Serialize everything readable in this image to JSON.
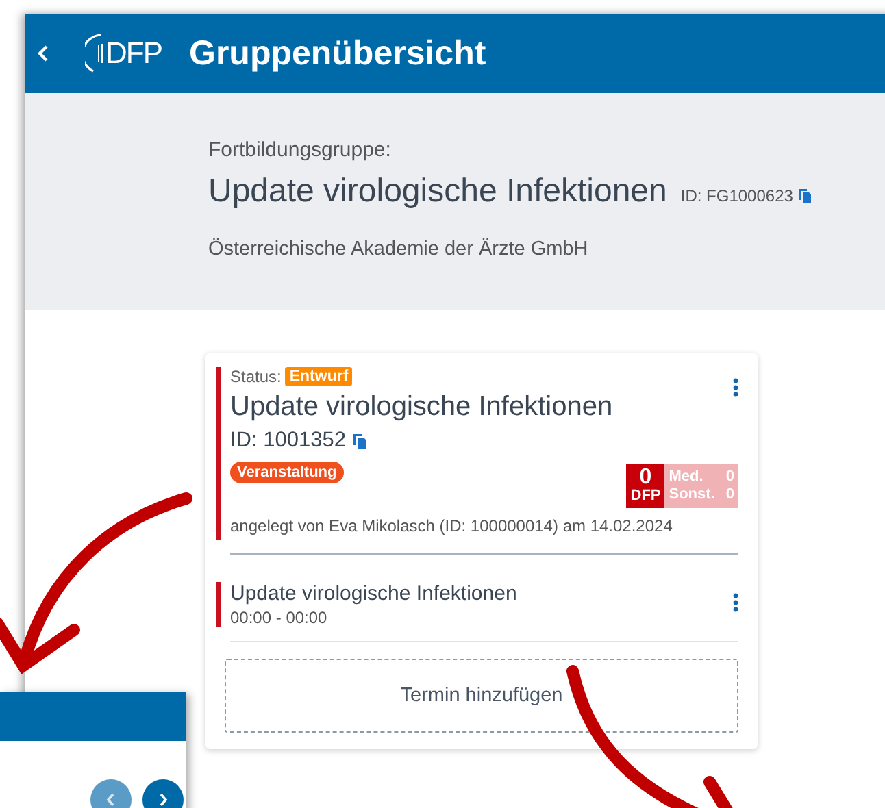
{
  "header": {
    "title": "Gruppenübersicht",
    "logo": "DFP"
  },
  "group": {
    "label": "Fortbildungsgruppe:",
    "name": "Update virologische Infektionen",
    "id": "ID: FG1000623",
    "organization": "Österreichische Akademie der Ärzte GmbH"
  },
  "event_card": {
    "status_label": "Status:",
    "status": "Entwurf",
    "title": "Update virologische Infektionen",
    "id": "ID: 1001352",
    "type_tag": "Veranstaltung",
    "credits": {
      "dfp_value": "0",
      "dfp_label": "DFP",
      "medical_label": "Med.",
      "medical_value": "0",
      "other_label": "Sonst.",
      "other_value": "0"
    },
    "created": "angelegt von Eva Mikolasch (ID: 100000014) am 14.02.2024"
  },
  "appointments": [
    {
      "title": "Update virologische Infektionen",
      "time": "00:00 - 00:00"
    }
  ],
  "add_button": "Termin hinzufügen",
  "secondary_window": {
    "buttons": [
      {
        "kind": "prev",
        "disabled": true
      },
      {
        "kind": "next",
        "disabled": false
      }
    ]
  }
}
